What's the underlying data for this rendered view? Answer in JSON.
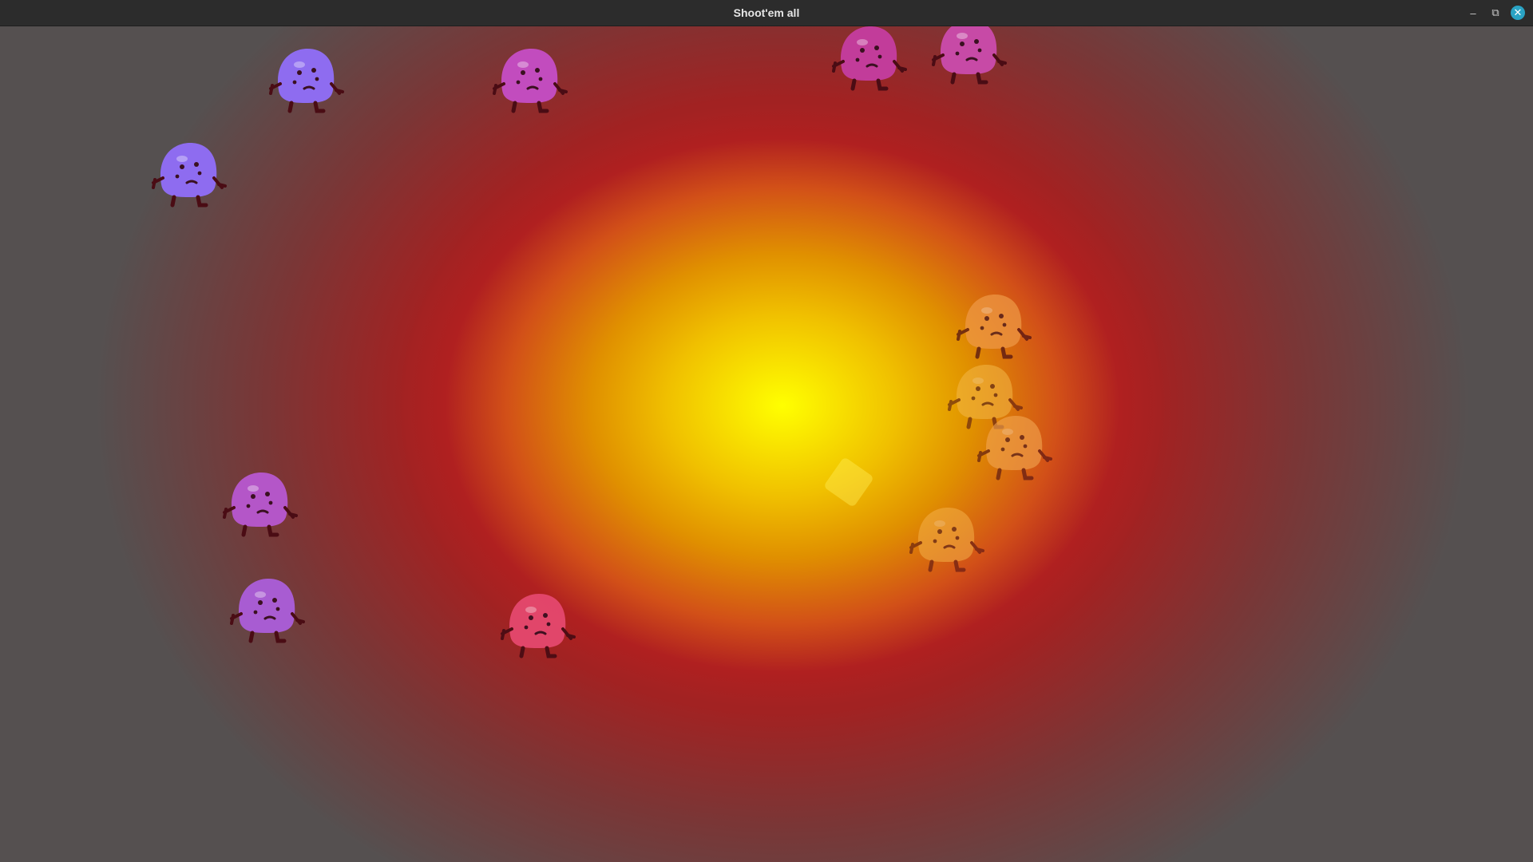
{
  "window": {
    "title": "Shoot'em all"
  },
  "controls": {
    "minimize_glyph": "–",
    "maximize_glyph": "⧉",
    "close_glyph": "✕"
  },
  "colors": {
    "explosion_core": "#ffff00",
    "explosion_edge": "#b02020",
    "monster_violet": "#8a6cf0",
    "monster_magenta": "#c04ab0",
    "monster_pink": "#e0489a",
    "monster_orange": "#f0a050"
  },
  "monsters": [
    {
      "name": "monster-violet",
      "color": "#8e6cf0",
      "opacity": 1
    },
    {
      "name": "monster-violet",
      "color": "#8e6cf0",
      "opacity": 1
    },
    {
      "name": "monster-magenta",
      "color": "#c24cbe",
      "opacity": 1
    },
    {
      "name": "monster-magenta",
      "color": "#c23c9a",
      "opacity": 1
    },
    {
      "name": "monster-magenta",
      "color": "#c74aa6",
      "opacity": 1
    },
    {
      "name": "monster-magenta",
      "color": "#b456c8",
      "opacity": 1
    },
    {
      "name": "monster-magenta",
      "color": "#a85cd2",
      "opacity": 1
    },
    {
      "name": "monster-pink",
      "color": "#e5486e",
      "opacity": 0.95
    },
    {
      "name": "monster-orange",
      "color": "#f09a48",
      "opacity": 0.7
    },
    {
      "name": "monster-orange",
      "color": "#f4b848",
      "opacity": 0.55
    },
    {
      "name": "monster-orange",
      "color": "#f3a652",
      "opacity": 0.6
    },
    {
      "name": "monster-orange",
      "color": "#f4b048",
      "opacity": 0.55
    }
  ]
}
